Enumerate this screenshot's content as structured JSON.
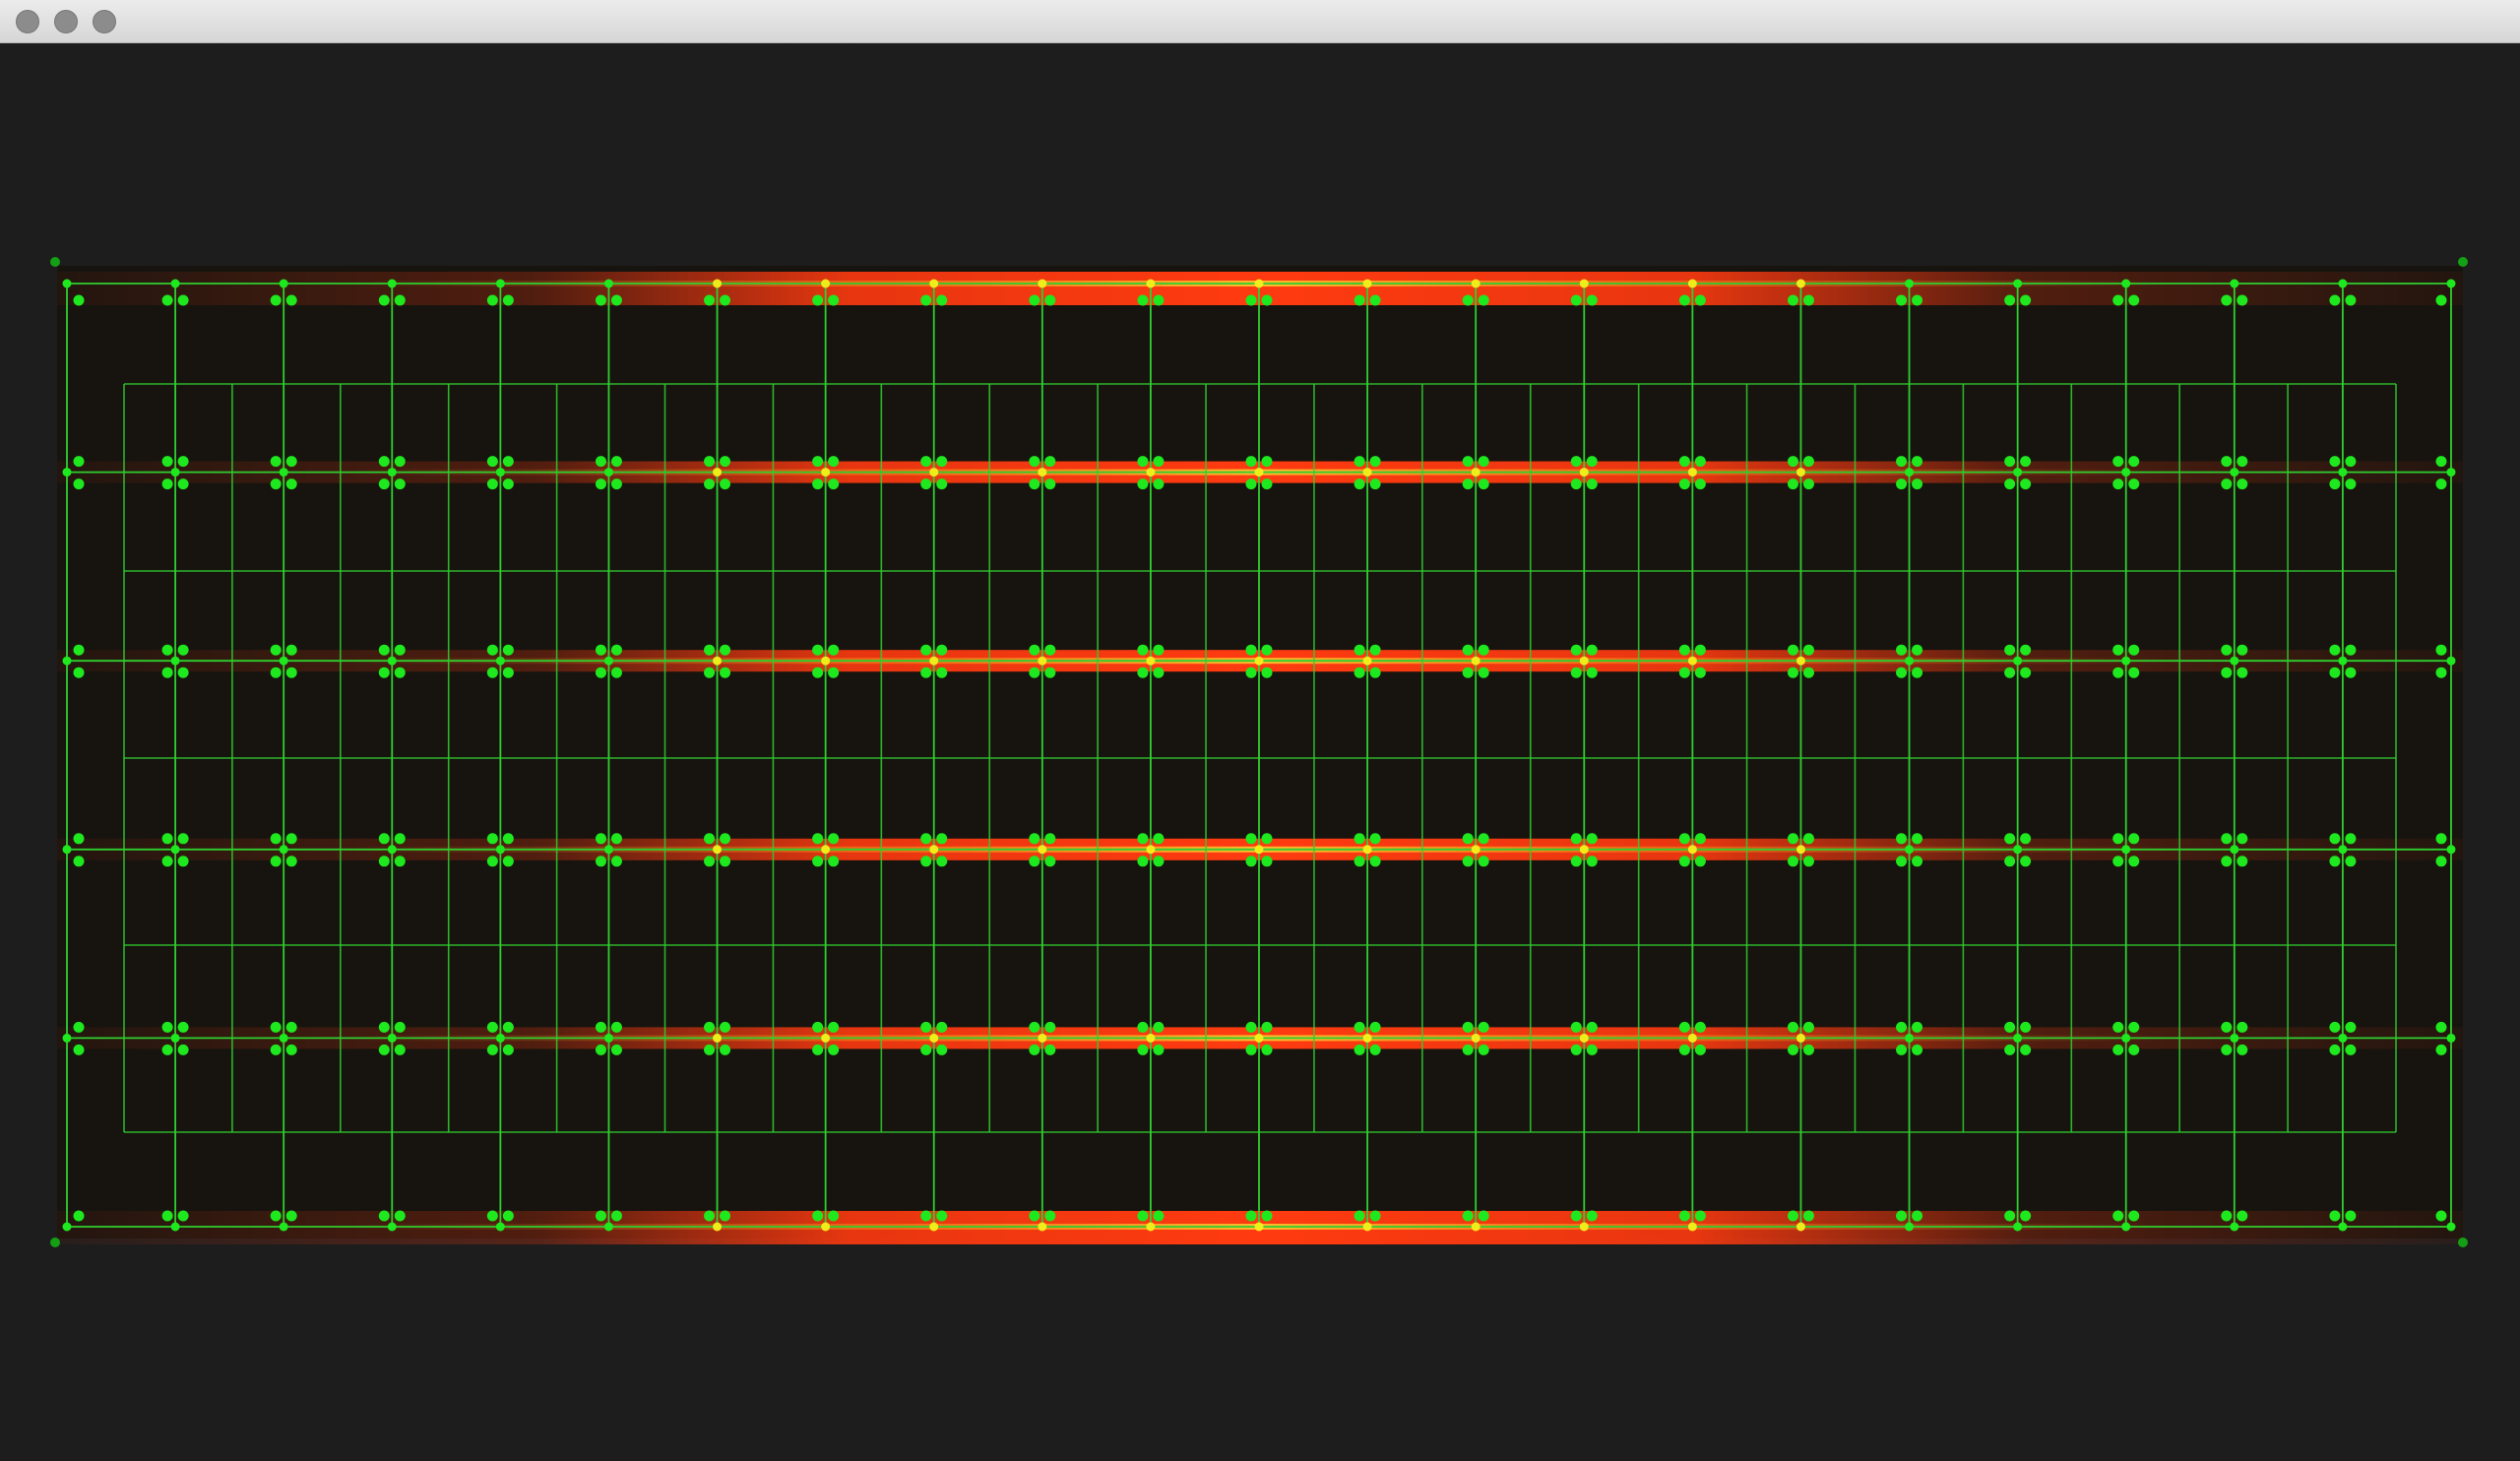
{
  "window": {
    "title": "",
    "buttons": {
      "close": "close-button",
      "minimize": "minimize-button",
      "maximize": "maximize-button"
    }
  },
  "viewer": {
    "background_color": "#1d1d1d",
    "image_background_color": "#17140f",
    "grid_color": "#2fcf2f",
    "point_color": "#1ee81e",
    "highlight_point_color": "#f4f01a",
    "band_color_core": "#ff3a10",
    "band_color_glow": "#ff7a10",
    "band_count": 6,
    "grid_columns": 23,
    "inner_grid_columns": 21,
    "inner_grid_rows": 4
  }
}
